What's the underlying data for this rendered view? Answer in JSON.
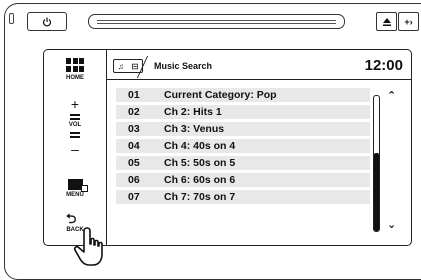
{
  "hardware": {
    "eject_icon": "eject-icon",
    "source_label": "+›"
  },
  "sidebar": {
    "home_label": "HOME",
    "vol_label": "VOL",
    "vol_plus": "+",
    "vol_minus": "–",
    "menu_label": "MENU",
    "back_label": "BACK",
    "back_icon": "⮌"
  },
  "header": {
    "title": "Music Search",
    "time": "12:00",
    "tab_icon_music": "♫",
    "tab_icon_list": "⊟"
  },
  "list": {
    "items": [
      {
        "num": "01",
        "label": "Current Category: Pop"
      },
      {
        "num": "02",
        "label": "Ch 2: Hits 1"
      },
      {
        "num": "03",
        "label": "Ch 3: Venus"
      },
      {
        "num": "04",
        "label": "Ch 4: 40s on 4"
      },
      {
        "num": "05",
        "label": "Ch 5: 50s on 5"
      },
      {
        "num": "06",
        "label": "Ch 6: 60s on 6"
      },
      {
        "num": "07",
        "label": "Ch 7: 70s on 7"
      }
    ]
  },
  "scroll": {
    "up_arrow": "⌃",
    "down_arrow": "⌄",
    "thumb_start": 0.42,
    "thumb_end": 1.0
  }
}
